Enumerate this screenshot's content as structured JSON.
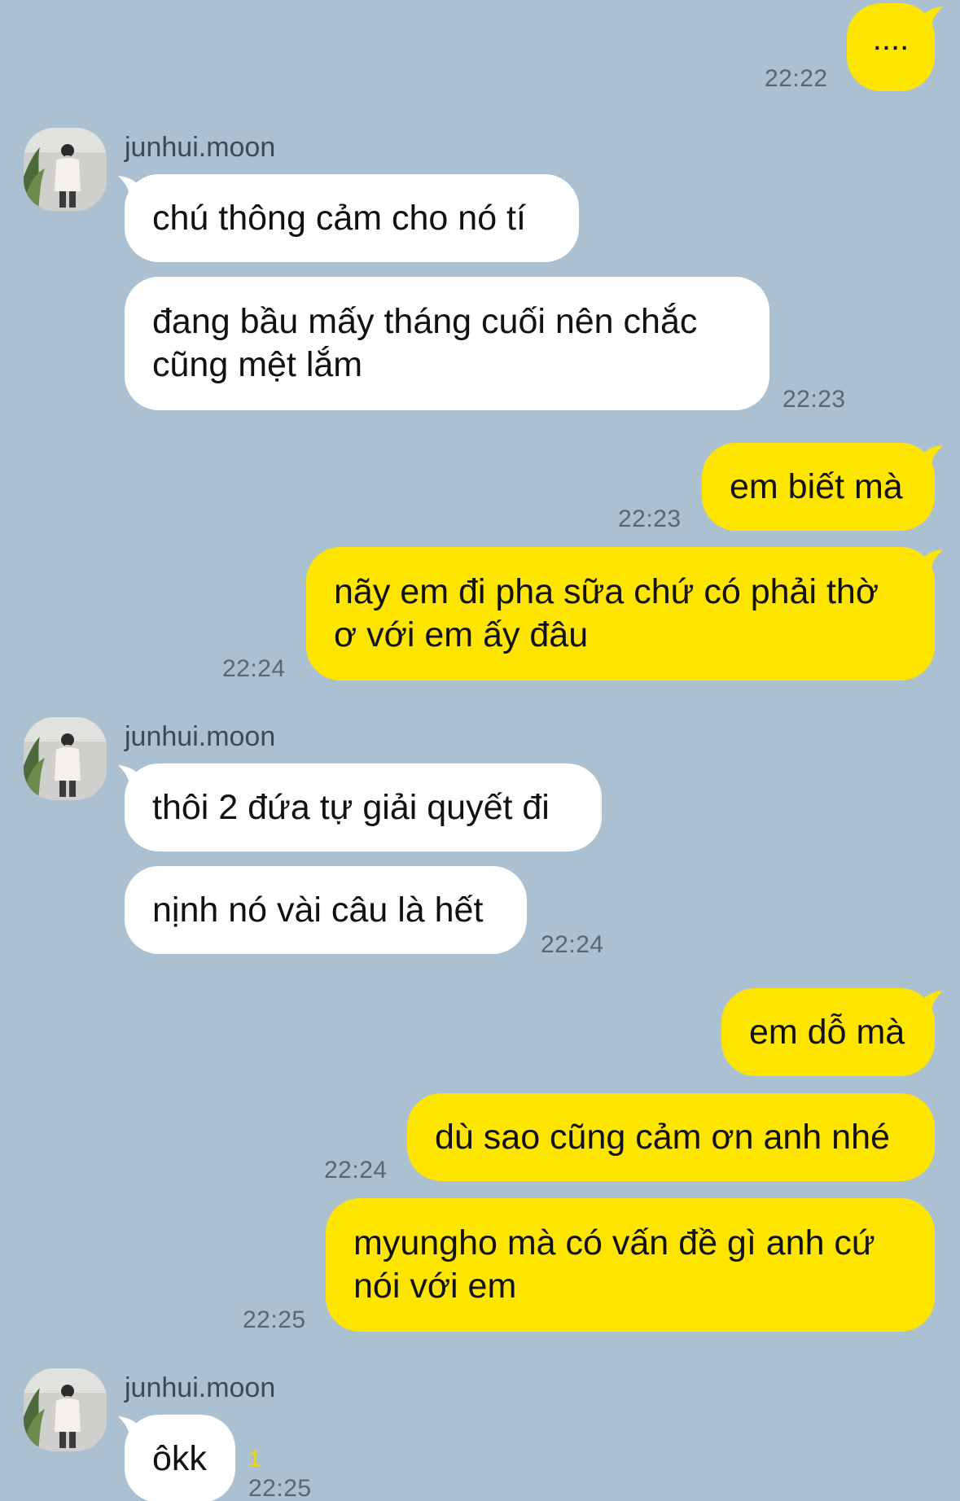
{
  "theme": {
    "background": "#abc1d2",
    "incoming_bubble": "#ffffff",
    "outgoing_bubble": "#fee500",
    "timestamp_color": "#5b6670",
    "unread_color": "#f2d600"
  },
  "messages": [
    {
      "id": "m1",
      "direction": "out",
      "text": "....",
      "time": "22:22"
    },
    {
      "id": "g1",
      "direction": "in",
      "sender": "junhui.moon",
      "avatar_icon": "profile-photo-avatar"
    },
    {
      "id": "m2",
      "direction": "in",
      "text": "chú thông cảm cho nó tí"
    },
    {
      "id": "m3",
      "direction": "in",
      "text": "đang bầu mấy tháng cuối nên chắc cũng mệt lắm",
      "time": "22:23"
    },
    {
      "id": "m4",
      "direction": "out",
      "text": "em biết mà",
      "time": "22:23"
    },
    {
      "id": "m5",
      "direction": "out",
      "text": "nãy em đi pha sữa chứ có phải thờ ơ với em ấy đâu",
      "time": "22:24"
    },
    {
      "id": "g2",
      "direction": "in",
      "sender": "junhui.moon",
      "avatar_icon": "profile-photo-avatar"
    },
    {
      "id": "m6",
      "direction": "in",
      "text": "thôi 2 đứa tự giải quyết đi"
    },
    {
      "id": "m7",
      "direction": "in",
      "text": "nịnh nó vài câu là hết",
      "time": "22:24"
    },
    {
      "id": "m8",
      "direction": "out",
      "text": "em dỗ mà"
    },
    {
      "id": "m9",
      "direction": "out",
      "text": "dù sao cũng cảm ơn anh nhé",
      "time": "22:24"
    },
    {
      "id": "m10",
      "direction": "out",
      "text": "myungho mà có vấn đề gì anh cứ nói với em",
      "time": "22:25"
    },
    {
      "id": "g3",
      "direction": "in",
      "sender": "junhui.moon",
      "avatar_icon": "profile-photo-avatar"
    },
    {
      "id": "m11",
      "direction": "in",
      "text": "ôkk",
      "time": "22:25",
      "unread": "1"
    }
  ]
}
